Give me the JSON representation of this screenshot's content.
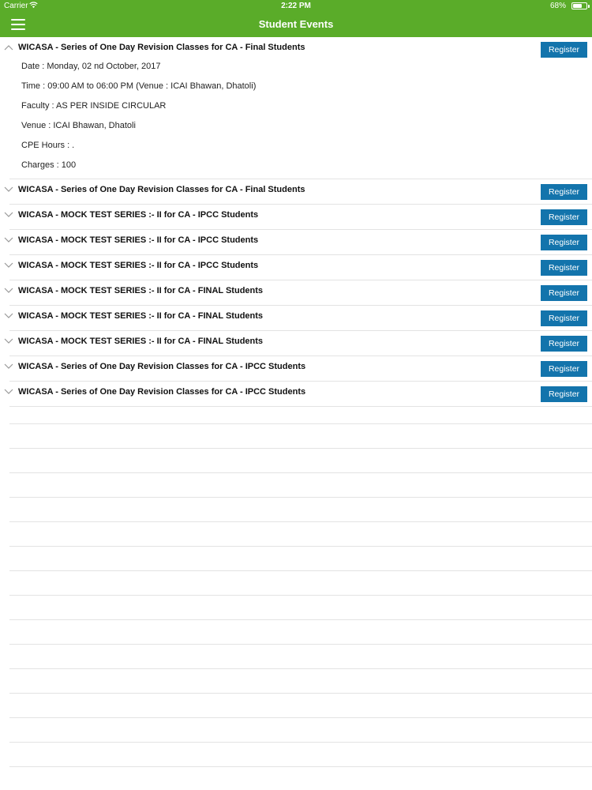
{
  "status_bar": {
    "carrier": "Carrier",
    "time": "2:22 PM",
    "battery": "68%",
    "battery_level": 0.68,
    "wifi_icon": "wifi-icon"
  },
  "header": {
    "title": "Student Events",
    "menu_icon": "hamburger-menu-icon",
    "background": "#5aac29"
  },
  "colors": {
    "button": "#1374ac",
    "divider": "#e3e3e3"
  },
  "events": [
    {
      "title": "WICASA - Series of One Day Revision Classes for CA - Final Students",
      "register": "Register",
      "expanded": true,
      "details": {
        "date": "Date : Monday, 02 nd October, 2017",
        "time": "Time : 09:00 AM to 06:00 PM (Venue : ICAI Bhawan, Dhatoli)",
        "faculty": "Faculty : AS PER INSIDE CIRCULAR",
        "venue": "Venue : ICAI Bhawan, Dhatoli",
        "cpe": "CPE Hours : .",
        "charges": "Charges : 100"
      }
    },
    {
      "title": "WICASA - Series of One Day Revision Classes for CA - Final Students",
      "register": "Register",
      "expanded": false
    },
    {
      "title": "WICASA - MOCK TEST SERIES :- II for CA - IPCC Students",
      "register": "Register",
      "expanded": false
    },
    {
      "title": "WICASA - MOCK TEST SERIES :- II for CA - IPCC Students",
      "register": "Register",
      "expanded": false
    },
    {
      "title": "WICASA - MOCK TEST SERIES :- II for CA - IPCC Students",
      "register": "Register",
      "expanded": false
    },
    {
      "title": "WICASA - MOCK TEST SERIES :- II for CA - FINAL Students",
      "register": "Register",
      "expanded": false
    },
    {
      "title": "WICASA - MOCK TEST SERIES :- II for CA - FINAL Students",
      "register": "Register",
      "expanded": false
    },
    {
      "title": "WICASA - MOCK TEST SERIES :- II for CA - FINAL Students",
      "register": "Register",
      "expanded": false
    },
    {
      "title": "WICASA - Series of One Day Revision Classes for CA - IPCC Students",
      "register": "Register",
      "expanded": false
    },
    {
      "title": "WICASA - Series of One Day Revision Classes for CA - IPCC Students",
      "register": "Register",
      "expanded": false
    }
  ]
}
